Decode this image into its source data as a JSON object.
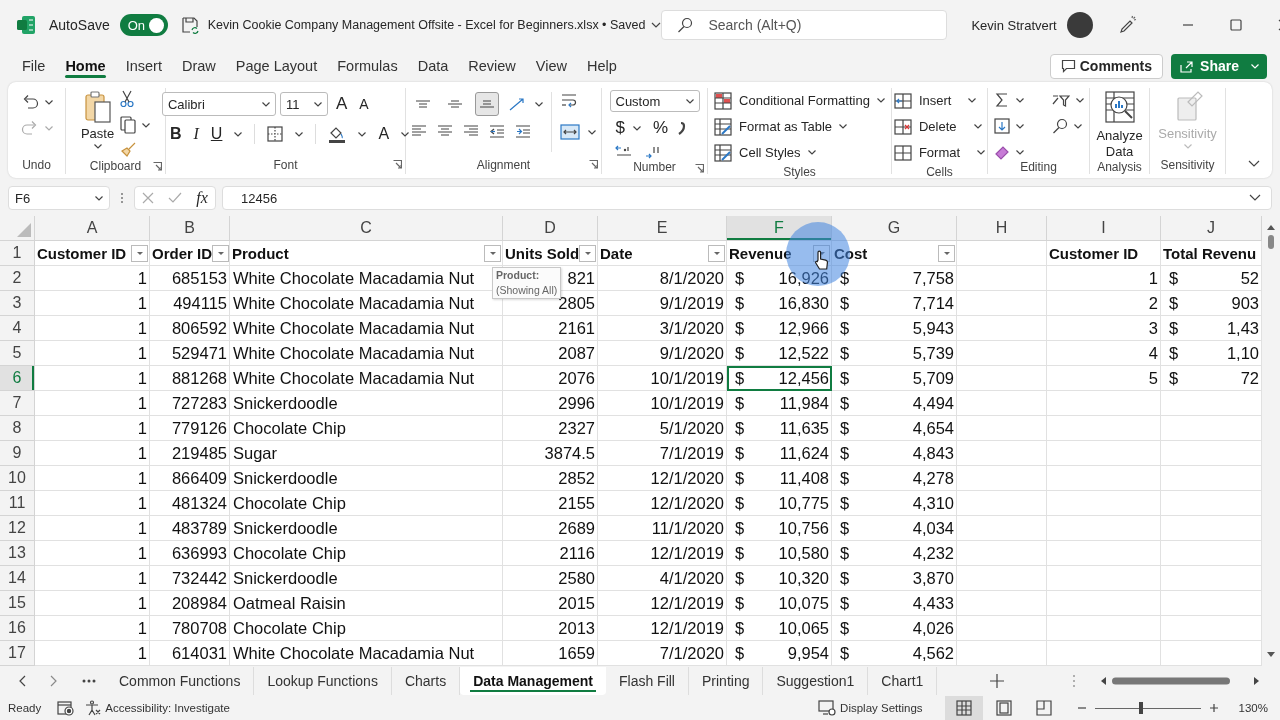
{
  "title_bar": {
    "autosave_label": "AutoSave",
    "autosave": {
      "label": "On",
      "on": true
    },
    "document_title": "Kevin Cookie Company Management Offsite - Excel for Beginners.xlsx • Saved",
    "search": {
      "placeholder": "Search (Alt+Q)"
    },
    "user_name": "Kevin Stratvert"
  },
  "menu_tabs": [
    {
      "label": "File",
      "selected": false
    },
    {
      "label": "Home",
      "selected": true
    },
    {
      "label": "Insert",
      "selected": false
    },
    {
      "label": "Draw",
      "selected": false
    },
    {
      "label": "Page Layout",
      "selected": false
    },
    {
      "label": "Formulas",
      "selected": false
    },
    {
      "label": "Data",
      "selected": false
    },
    {
      "label": "Review",
      "selected": false
    },
    {
      "label": "View",
      "selected": false
    },
    {
      "label": "Help",
      "selected": false
    }
  ],
  "comments_button": "Comments",
  "share_button": "Share",
  "ribbon": {
    "groups": [
      {
        "label": "Undo",
        "launcher": false
      },
      {
        "label": "Clipboard",
        "launcher": true
      },
      {
        "label": "Font",
        "launcher": true
      },
      {
        "label": "Alignment",
        "launcher": true
      },
      {
        "label": "Number",
        "launcher": true
      },
      {
        "label": "Styles",
        "launcher": false
      },
      {
        "label": "Cells",
        "launcher": false
      },
      {
        "label": "Editing",
        "launcher": false
      },
      {
        "label": "Analysis",
        "launcher": false
      },
      {
        "label": "Sensitivity",
        "launcher": false
      }
    ],
    "paste_label": "Paste",
    "font_name": "Calibri",
    "font_size": "11",
    "font_grow": "A",
    "font_shrink": "A",
    "font_styles": [
      "B",
      "I",
      "U"
    ],
    "font_color": "A",
    "alignment": [
      {
        "selected": false
      },
      {
        "selected": false
      },
      {
        "selected": true
      }
    ],
    "number_format": "Custom",
    "currency": "$",
    "percent": "%",
    "styles": [
      "Conditional Formatting",
      "Format as Table",
      "Cell Styles"
    ],
    "cells": [
      "Insert",
      "Delete",
      "Format"
    ],
    "analyze": "Analyze Data",
    "sensitivity": {
      "label": "Sensitivity",
      "disabled": true
    }
  },
  "formula_bar": {
    "name_box": "F6",
    "function_label": "fx",
    "value": "12456"
  },
  "grid": {
    "columns": [
      {
        "letter": "A",
        "selected": false
      },
      {
        "letter": "B",
        "selected": false
      },
      {
        "letter": "C",
        "selected": false
      },
      {
        "letter": "D",
        "selected": false
      },
      {
        "letter": "E",
        "selected": false
      },
      {
        "letter": "F",
        "selected": true
      },
      {
        "letter": "G",
        "selected": false
      },
      {
        "letter": "H",
        "selected": false
      },
      {
        "letter": "I",
        "selected": false
      },
      {
        "letter": "J",
        "selected": false
      }
    ],
    "rows": [
      {
        "label": "1",
        "selected": false,
        "cells": [
          {
            "kind": "header",
            "text": "Customer ID",
            "filter": true
          },
          {
            "kind": "header",
            "text": "Order ID",
            "filter": true
          },
          {
            "kind": "header",
            "text": "Product",
            "filter": true
          },
          {
            "kind": "header",
            "text": "Units Sold",
            "filter": true
          },
          {
            "kind": "header",
            "text": "Date",
            "filter": true
          },
          {
            "kind": "header",
            "text": "Revenue",
            "filter": true
          },
          {
            "kind": "header",
            "text": "Cost",
            "filter": true
          },
          null,
          {
            "kind": "header",
            "text": "Customer ID",
            "filter": false
          },
          {
            "kind": "header",
            "text": "Total Revenu",
            "filter": false
          }
        ]
      },
      {
        "label": "2",
        "selected": false,
        "cells": [
          {
            "kind": "number",
            "text": "1"
          },
          {
            "kind": "number",
            "text": "685153"
          },
          {
            "kind": "text",
            "text": "White Chocolate Macadamia Nut"
          },
          {
            "kind": "number",
            "text": "821"
          },
          {
            "kind": "number",
            "text": "8/1/2020"
          },
          {
            "kind": "accounting",
            "symbol": "$",
            "text": "16,926"
          },
          {
            "kind": "accounting",
            "symbol": "$",
            "text": "7,758"
          },
          null,
          {
            "kind": "number",
            "text": "1"
          },
          {
            "kind": "accounting",
            "symbol": "$",
            "text": "52"
          }
        ]
      },
      {
        "label": "3",
        "selected": false,
        "cells": [
          {
            "kind": "number",
            "text": "1"
          },
          {
            "kind": "number",
            "text": "494115"
          },
          {
            "kind": "text",
            "text": "White Chocolate Macadamia Nut"
          },
          {
            "kind": "number",
            "text": "2805"
          },
          {
            "kind": "number",
            "text": "9/1/2019"
          },
          {
            "kind": "accounting",
            "symbol": "$",
            "text": "16,830"
          },
          {
            "kind": "accounting",
            "symbol": "$",
            "text": "7,714"
          },
          null,
          {
            "kind": "number",
            "text": "2"
          },
          {
            "kind": "accounting",
            "symbol": "$",
            "text": "903"
          }
        ]
      },
      {
        "label": "4",
        "selected": false,
        "cells": [
          {
            "kind": "number",
            "text": "1"
          },
          {
            "kind": "number",
            "text": "806592"
          },
          {
            "kind": "text",
            "text": "White Chocolate Macadamia Nut"
          },
          {
            "kind": "number",
            "text": "2161"
          },
          {
            "kind": "number",
            "text": "3/1/2020"
          },
          {
            "kind": "accounting",
            "symbol": "$",
            "text": "12,966"
          },
          {
            "kind": "accounting",
            "symbol": "$",
            "text": "5,943"
          },
          null,
          {
            "kind": "number",
            "text": "3"
          },
          {
            "kind": "accounting",
            "symbol": "$",
            "text": "1,43"
          }
        ]
      },
      {
        "label": "5",
        "selected": false,
        "cells": [
          {
            "kind": "number",
            "text": "1"
          },
          {
            "kind": "number",
            "text": "529471"
          },
          {
            "kind": "text",
            "text": "White Chocolate Macadamia Nut"
          },
          {
            "kind": "number",
            "text": "2087"
          },
          {
            "kind": "number",
            "text": "9/1/2020"
          },
          {
            "kind": "accounting",
            "symbol": "$",
            "text": "12,522"
          },
          {
            "kind": "accounting",
            "symbol": "$",
            "text": "5,739"
          },
          null,
          {
            "kind": "number",
            "text": "4"
          },
          {
            "kind": "accounting",
            "symbol": "$",
            "text": "1,10"
          }
        ]
      },
      {
        "label": "6",
        "selected": true,
        "cells": [
          {
            "kind": "number",
            "text": "1"
          },
          {
            "kind": "number",
            "text": "881268"
          },
          {
            "kind": "text",
            "text": "White Chocolate Macadamia Nut"
          },
          {
            "kind": "number",
            "text": "2076"
          },
          {
            "kind": "number",
            "text": "10/1/2019"
          },
          {
            "kind": "accounting",
            "symbol": "$",
            "text": "12,456"
          },
          {
            "kind": "accounting",
            "symbol": "$",
            "text": "5,709"
          },
          null,
          {
            "kind": "number",
            "text": "5"
          },
          {
            "kind": "accounting",
            "symbol": "$",
            "text": "72"
          }
        ]
      },
      {
        "label": "7",
        "selected": false,
        "cells": [
          {
            "kind": "number",
            "text": "1"
          },
          {
            "kind": "number",
            "text": "727283"
          },
          {
            "kind": "text",
            "text": "Snickerdoodle"
          },
          {
            "kind": "number",
            "text": "2996"
          },
          {
            "kind": "number",
            "text": "10/1/2019"
          },
          {
            "kind": "accounting",
            "symbol": "$",
            "text": "11,984"
          },
          {
            "kind": "accounting",
            "symbol": "$",
            "text": "4,494"
          },
          null,
          null,
          null
        ]
      },
      {
        "label": "8",
        "selected": false,
        "cells": [
          {
            "kind": "number",
            "text": "1"
          },
          {
            "kind": "number",
            "text": "779126"
          },
          {
            "kind": "text",
            "text": "Chocolate Chip"
          },
          {
            "kind": "number",
            "text": "2327"
          },
          {
            "kind": "number",
            "text": "5/1/2020"
          },
          {
            "kind": "accounting",
            "symbol": "$",
            "text": "11,635"
          },
          {
            "kind": "accounting",
            "symbol": "$",
            "text": "4,654"
          },
          null,
          null,
          null
        ]
      },
      {
        "label": "9",
        "selected": false,
        "cells": [
          {
            "kind": "number",
            "text": "1"
          },
          {
            "kind": "number",
            "text": "219485"
          },
          {
            "kind": "text",
            "text": "Sugar"
          },
          {
            "kind": "number",
            "text": "3874.5"
          },
          {
            "kind": "number",
            "text": "7/1/2019"
          },
          {
            "kind": "accounting",
            "symbol": "$",
            "text": "11,624"
          },
          {
            "kind": "accounting",
            "symbol": "$",
            "text": "4,843"
          },
          null,
          null,
          null
        ]
      },
      {
        "label": "10",
        "selected": false,
        "cells": [
          {
            "kind": "number",
            "text": "1"
          },
          {
            "kind": "number",
            "text": "866409"
          },
          {
            "kind": "text",
            "text": "Snickerdoodle"
          },
          {
            "kind": "number",
            "text": "2852"
          },
          {
            "kind": "number",
            "text": "12/1/2020"
          },
          {
            "kind": "accounting",
            "symbol": "$",
            "text": "11,408"
          },
          {
            "kind": "accounting",
            "symbol": "$",
            "text": "4,278"
          },
          null,
          null,
          null
        ]
      },
      {
        "label": "11",
        "selected": false,
        "cells": [
          {
            "kind": "number",
            "text": "1"
          },
          {
            "kind": "number",
            "text": "481324"
          },
          {
            "kind": "text",
            "text": "Chocolate Chip"
          },
          {
            "kind": "number",
            "text": "2155"
          },
          {
            "kind": "number",
            "text": "12/1/2020"
          },
          {
            "kind": "accounting",
            "symbol": "$",
            "text": "10,775"
          },
          {
            "kind": "accounting",
            "symbol": "$",
            "text": "4,310"
          },
          null,
          null,
          null
        ]
      },
      {
        "label": "12",
        "selected": false,
        "cells": [
          {
            "kind": "number",
            "text": "1"
          },
          {
            "kind": "number",
            "text": "483789"
          },
          {
            "kind": "text",
            "text": "Snickerdoodle"
          },
          {
            "kind": "number",
            "text": "2689"
          },
          {
            "kind": "number",
            "text": "11/1/2020"
          },
          {
            "kind": "accounting",
            "symbol": "$",
            "text": "10,756"
          },
          {
            "kind": "accounting",
            "symbol": "$",
            "text": "4,034"
          },
          null,
          null,
          null
        ]
      },
      {
        "label": "13",
        "selected": false,
        "cells": [
          {
            "kind": "number",
            "text": "1"
          },
          {
            "kind": "number",
            "text": "636993"
          },
          {
            "kind": "text",
            "text": "Chocolate Chip"
          },
          {
            "kind": "number",
            "text": "2116"
          },
          {
            "kind": "number",
            "text": "12/1/2019"
          },
          {
            "kind": "accounting",
            "symbol": "$",
            "text": "10,580"
          },
          {
            "kind": "accounting",
            "symbol": "$",
            "text": "4,232"
          },
          null,
          null,
          null
        ]
      },
      {
        "label": "14",
        "selected": false,
        "cells": [
          {
            "kind": "number",
            "text": "1"
          },
          {
            "kind": "number",
            "text": "732442"
          },
          {
            "kind": "text",
            "text": "Snickerdoodle"
          },
          {
            "kind": "number",
            "text": "2580"
          },
          {
            "kind": "number",
            "text": "4/1/2020"
          },
          {
            "kind": "accounting",
            "symbol": "$",
            "text": "10,320"
          },
          {
            "kind": "accounting",
            "symbol": "$",
            "text": "3,870"
          },
          null,
          null,
          null
        ]
      },
      {
        "label": "15",
        "selected": false,
        "cells": [
          {
            "kind": "number",
            "text": "1"
          },
          {
            "kind": "number",
            "text": "208984"
          },
          {
            "kind": "text",
            "text": "Oatmeal Raisin"
          },
          {
            "kind": "number",
            "text": "2015"
          },
          {
            "kind": "number",
            "text": "12/1/2019"
          },
          {
            "kind": "accounting",
            "symbol": "$",
            "text": "10,075"
          },
          {
            "kind": "accounting",
            "symbol": "$",
            "text": "4,433"
          },
          null,
          null,
          null
        ]
      },
      {
        "label": "16",
        "selected": false,
        "cells": [
          {
            "kind": "number",
            "text": "1"
          },
          {
            "kind": "number",
            "text": "780708"
          },
          {
            "kind": "text",
            "text": "Chocolate Chip"
          },
          {
            "kind": "number",
            "text": "2013"
          },
          {
            "kind": "number",
            "text": "12/1/2019"
          },
          {
            "kind": "accounting",
            "symbol": "$",
            "text": "10,065"
          },
          {
            "kind": "accounting",
            "symbol": "$",
            "text": "4,026"
          },
          null,
          null,
          null
        ]
      },
      {
        "label": "17",
        "selected": false,
        "cells": [
          {
            "kind": "number",
            "text": "1"
          },
          {
            "kind": "number",
            "text": "614031"
          },
          {
            "kind": "text",
            "text": "White Chocolate Macadamia Nut"
          },
          {
            "kind": "number",
            "text": "1659"
          },
          {
            "kind": "number",
            "text": "7/1/2020"
          },
          {
            "kind": "accounting",
            "symbol": "$",
            "text": "9,954"
          },
          {
            "kind": "accounting",
            "symbol": "$",
            "text": "4,562"
          },
          null,
          null,
          null
        ]
      }
    ],
    "tooltip": {
      "title": "Product:",
      "text": "(Showing All)"
    }
  },
  "sheet_tabs": [
    {
      "label": "Common Functions",
      "selected": false
    },
    {
      "label": "Lookup Functions",
      "selected": false
    },
    {
      "label": "Charts",
      "selected": false
    },
    {
      "label": "Data Management",
      "selected": true
    },
    {
      "label": "Flash Fill",
      "selected": false
    },
    {
      "label": "Printing",
      "selected": false
    },
    {
      "label": "Suggestion1",
      "selected": false
    },
    {
      "label": "Chart1",
      "selected": false
    }
  ],
  "status_bar": {
    "status": "Ready",
    "accessibility": "Accessibility: Investigate",
    "display_settings": "Display Settings",
    "views": [
      {
        "selected": true
      },
      {
        "selected": false
      },
      {
        "selected": false
      }
    ],
    "zoom": {
      "level": 0.44
    },
    "zoom_percent": "130%"
  }
}
